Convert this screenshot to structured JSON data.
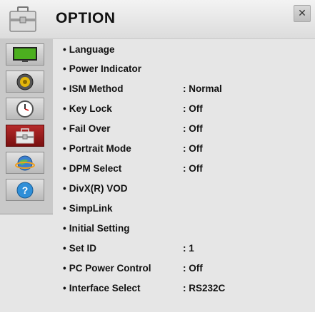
{
  "header": {
    "title": "OPTION",
    "close_symbol": "✕"
  },
  "sidebar": {
    "items": [
      {
        "icon": "tv-picture-icon"
      },
      {
        "icon": "speaker-icon"
      },
      {
        "icon": "clock-icon"
      },
      {
        "icon": "toolbox-option-icon",
        "active": true
      },
      {
        "icon": "globe-network-icon"
      },
      {
        "icon": "help-icon"
      }
    ]
  },
  "menu": {
    "items": [
      {
        "label": "Language",
        "value": ""
      },
      {
        "label": "Power Indicator",
        "value": ""
      },
      {
        "label": "ISM Method",
        "value": "Normal"
      },
      {
        "label": "Key Lock",
        "value": "Off"
      },
      {
        "label": "Fail Over",
        "value": "Off"
      },
      {
        "label": "Portrait Mode",
        "value": "Off"
      },
      {
        "label": "DPM Select",
        "value": "Off"
      },
      {
        "label": "DivX(R) VOD",
        "value": ""
      },
      {
        "label": "SimpLink",
        "value": ""
      },
      {
        "label": "Initial Setting",
        "value": ""
      },
      {
        "label": "Set ID",
        "value": "1"
      },
      {
        "label": "PC Power Control",
        "value": "Off"
      },
      {
        "label": "Interface Select",
        "value": "RS232C"
      }
    ]
  }
}
